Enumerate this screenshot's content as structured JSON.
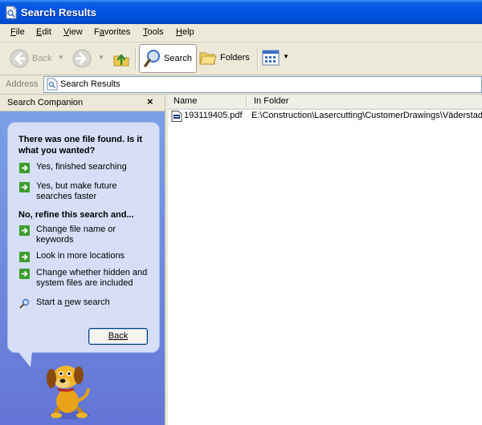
{
  "window": {
    "title": "Search Results"
  },
  "menu": [
    {
      "pre": "",
      "key": "F",
      "post": "ile"
    },
    {
      "pre": "",
      "key": "E",
      "post": "dit"
    },
    {
      "pre": "",
      "key": "V",
      "post": "iew"
    },
    {
      "pre": "F",
      "key": "a",
      "post": "vorites"
    },
    {
      "pre": "",
      "key": "T",
      "post": "ools"
    },
    {
      "pre": "",
      "key": "H",
      "post": "elp"
    }
  ],
  "toolbar": {
    "back": "Back",
    "search": "Search",
    "folders": "Folders"
  },
  "address": {
    "label": "Address",
    "value": "Search Results"
  },
  "companion": {
    "title": "Search Companion",
    "close": "×",
    "question": "There was one file found.  Is it what you wanted?",
    "options_yes": [
      "Yes, finished searching",
      "Yes, but make future searches faster"
    ],
    "refine_heading": "No, refine this search and...",
    "options_refine": [
      "Change file name or keywords",
      "Look in more locations",
      "Change whether hidden and system files are included"
    ],
    "new_search": {
      "pre": "Start a ",
      "key": "n",
      "post": "ew search"
    },
    "back_button": "Back"
  },
  "results": {
    "columns": [
      "Name",
      "In Folder"
    ],
    "rows": [
      {
        "name": "193119405.pdf",
        "folder": "E:\\Construction\\Lasercutting\\CustomerDrawings\\Väderstad"
      }
    ]
  },
  "colors": {
    "titlebar": "#0054e3",
    "chrome": "#ece9d8",
    "pane": "#6f8ede",
    "bubble": "#d6dff7",
    "arrow_green": "#3d9e2e"
  }
}
